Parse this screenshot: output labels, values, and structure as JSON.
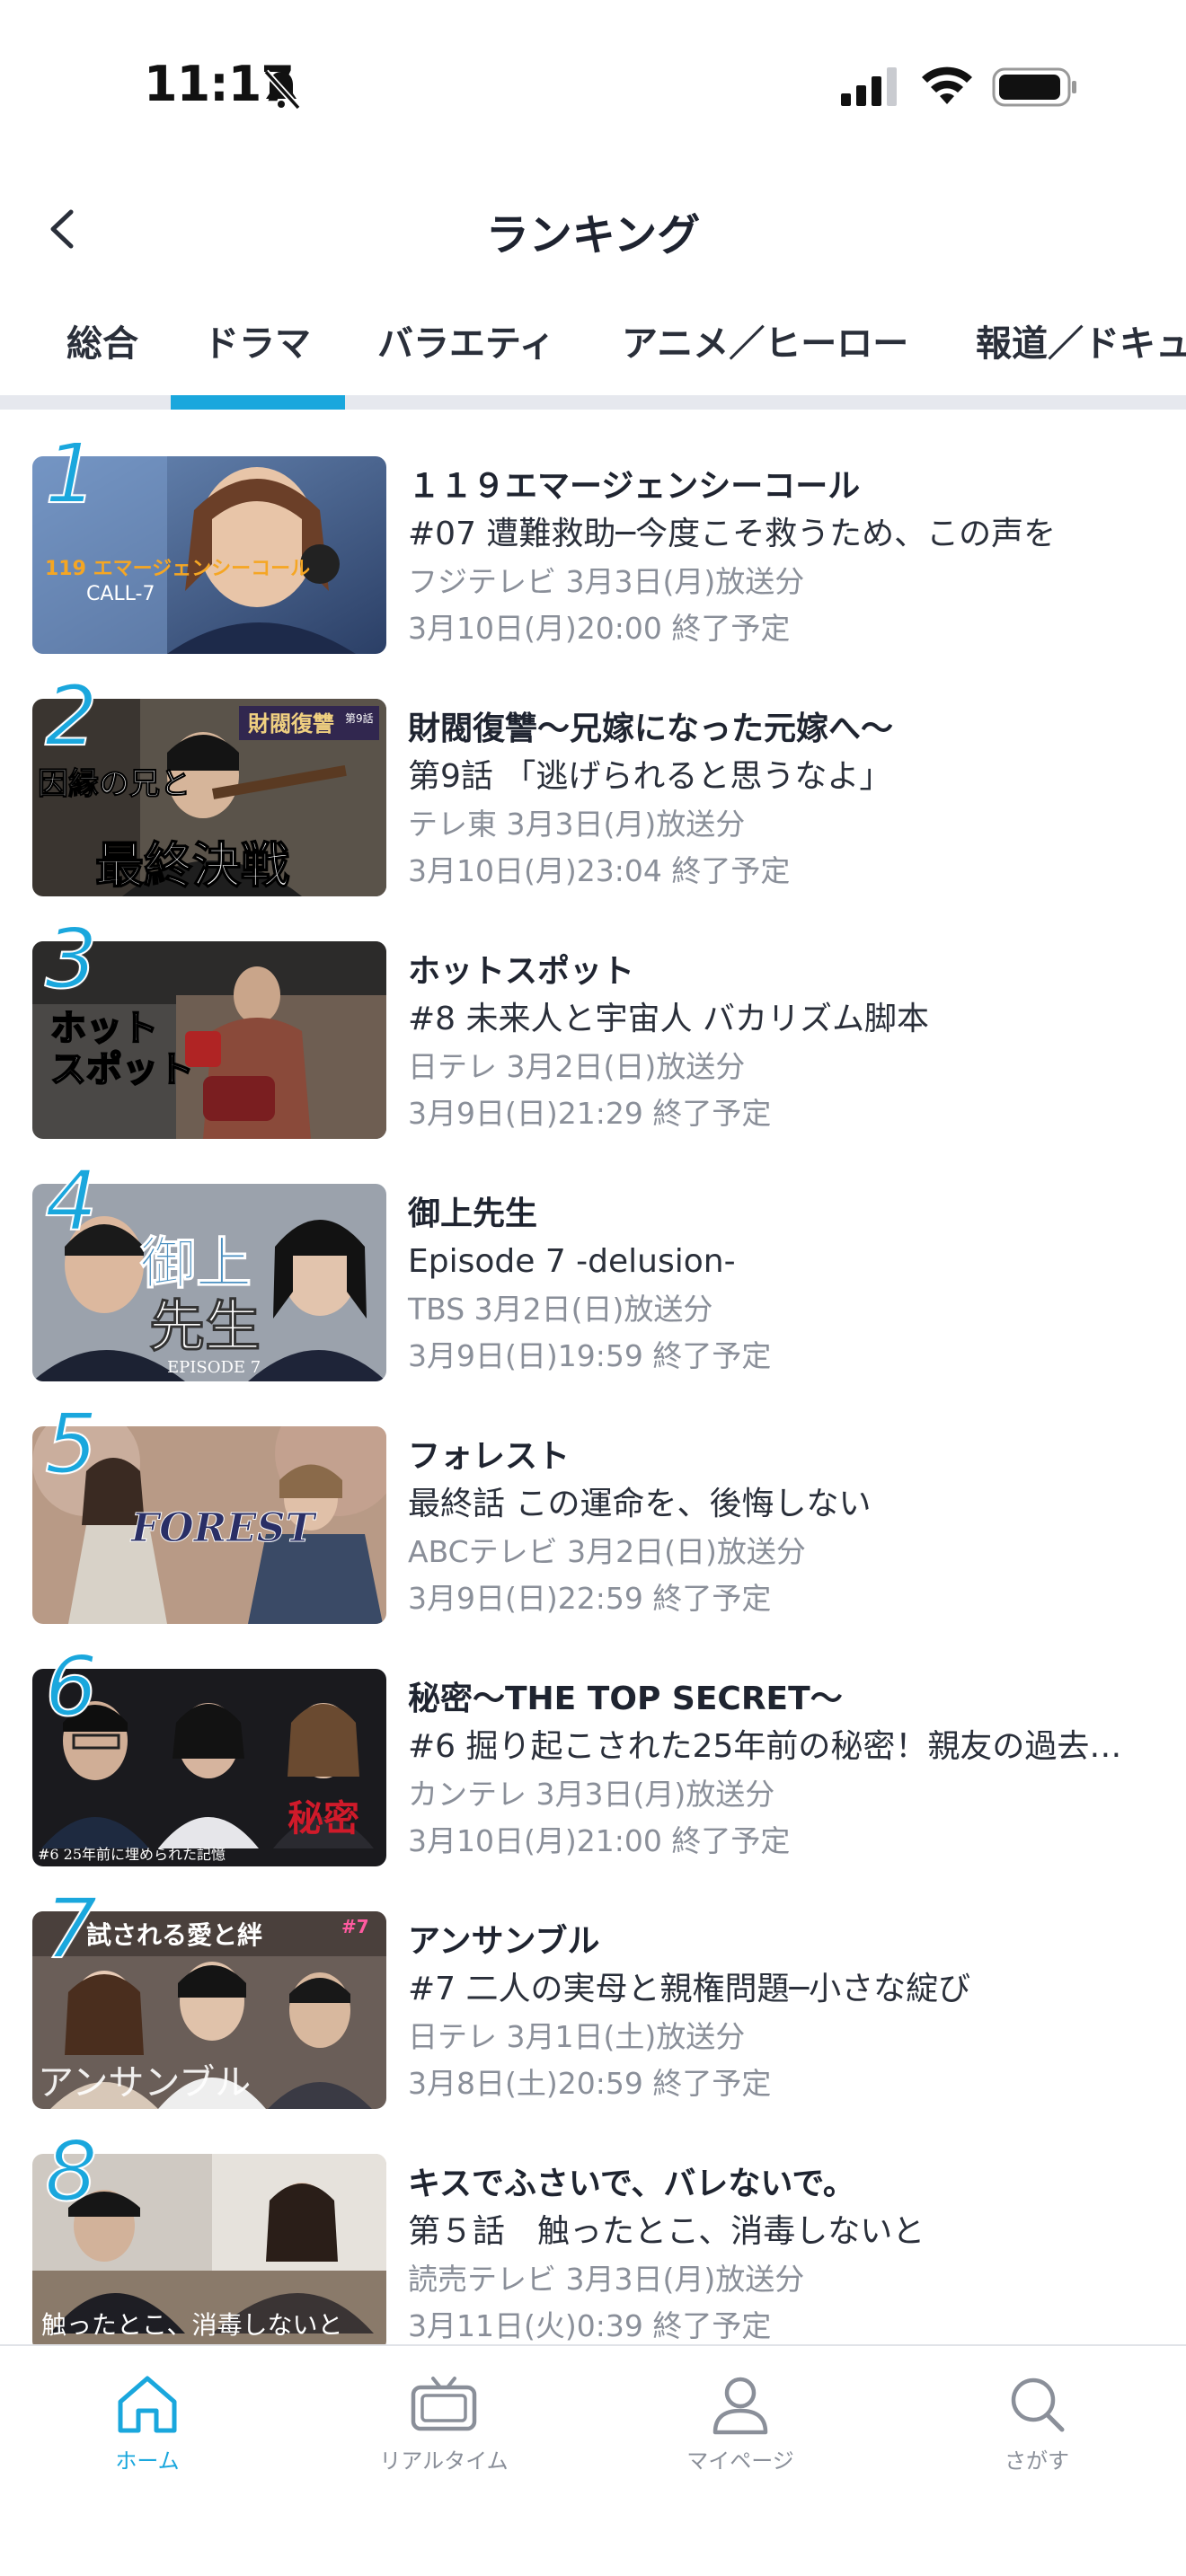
{
  "status_bar": {
    "time": "11:17"
  },
  "header": {
    "title": "ランキング"
  },
  "tabs": [
    {
      "label": "総合"
    },
    {
      "label": "ドラマ",
      "active": true
    },
    {
      "label": "バラエティ"
    },
    {
      "label": "アニメ／ヒーロー"
    },
    {
      "label": "報道／ドキュ"
    }
  ],
  "items": [
    {
      "rank": "1",
      "title": "１１９エマージェンシーコール",
      "subtitle": "#07 遭難救助─今度こそ救うため、この声を",
      "broadcast": "フジテレビ 3月3日(月)放送分",
      "expiry": "3月10日(月)20:00 終了予定",
      "thumb_text": [
        "119 エマージェンシーコール",
        "CALL-7"
      ]
    },
    {
      "rank": "2",
      "title": "財閥復讐〜兄嫁になった元嫁へ〜",
      "subtitle": "第9話 「逃げられると思うなよ」",
      "broadcast": "テレ東 3月3日(月)放送分",
      "expiry": "3月10日(月)23:04 終了予定",
      "thumb_text": [
        "因縁の兄と",
        "最終決戦",
        "財閥復讐",
        "第9話"
      ]
    },
    {
      "rank": "3",
      "title": "ホットスポット",
      "subtitle": "#8 未来人と宇宙人 バカリズム脚本",
      "broadcast": "日テレ 3月2日(日)放送分",
      "expiry": "3月9日(日)21:29 終了予定",
      "thumb_text": [
        "ホット",
        "スポット"
      ]
    },
    {
      "rank": "4",
      "title": "御上先生",
      "subtitle": "Episode 7 -delusion-",
      "broadcast": "TBS 3月2日(日)放送分",
      "expiry": "3月9日(日)19:59 終了予定",
      "thumb_text": [
        "御上",
        "先生",
        "EPISODE 7"
      ]
    },
    {
      "rank": "5",
      "title": "フォレスト",
      "subtitle": "最終話 この運命を、後悔しない",
      "broadcast": "ABCテレビ 3月2日(日)放送分",
      "expiry": "3月9日(日)22:59 終了予定",
      "thumb_text": [
        "FOREST"
      ]
    },
    {
      "rank": "6",
      "title": "秘密〜THE TOP SECRET〜",
      "subtitle": "#6 掘り起こされた25年前の秘密！親友の過去…",
      "broadcast": "カンテレ 3月3日(月)放送分",
      "expiry": "3月10日(月)21:00 終了予定",
      "thumb_text": [
        "#6 25年前に埋められた記憶",
        "秘密"
      ]
    },
    {
      "rank": "7",
      "title": "アンサンブル",
      "subtitle": "#7 二人の実母と親権問題─小さな綻び",
      "broadcast": "日テレ 3月1日(土)放送分",
      "expiry": "3月8日(土)20:59 終了予定",
      "thumb_text": [
        "試される愛と絆",
        "#7",
        "アンサンブル"
      ]
    },
    {
      "rank": "8",
      "title": "キスでふさいで、バレないで。",
      "subtitle": "第５話　触ったとこ、消毒しないと",
      "broadcast": "読売テレビ 3月3日(月)放送分",
      "expiry": "3月11日(火)0:39 終了予定",
      "thumb_text": [
        "触ったとこ、消毒しないと"
      ]
    }
  ],
  "bottom_nav": [
    {
      "label": "ホーム",
      "icon": "home-icon",
      "active": true
    },
    {
      "label": "リアルタイム",
      "icon": "tv-icon"
    },
    {
      "label": "マイページ",
      "icon": "person-icon"
    },
    {
      "label": "さがす",
      "icon": "search-icon"
    }
  ],
  "colors": {
    "accent": "#1aa7dd",
    "text": "#1f2430",
    "muted": "#8a8f99",
    "divider": "#e6e8ee"
  }
}
